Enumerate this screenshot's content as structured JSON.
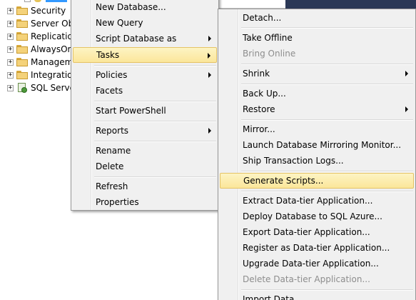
{
  "tree": {
    "items": [
      {
        "label": "Security",
        "icon": "folder-icon"
      },
      {
        "label": "Server Ob",
        "icon": "folder-icon"
      },
      {
        "label": "Replicatio",
        "icon": "folder-icon"
      },
      {
        "label": "AlwaysOr",
        "icon": "folder-icon"
      },
      {
        "label": "Managem",
        "icon": "folder-icon"
      },
      {
        "label": "Integratio",
        "icon": "folder-icon"
      },
      {
        "label": "SQL Serve",
        "icon": "server-icon"
      }
    ],
    "expander_glyph": "+"
  },
  "context_menu": {
    "items": [
      {
        "label": "New Database..."
      },
      {
        "label": "New Query"
      },
      {
        "label": "Script Database as",
        "submenu": true
      },
      {
        "label": "Tasks",
        "submenu": true,
        "highlighted": true
      },
      {
        "label": "Policies",
        "submenu": true
      },
      {
        "label": "Facets"
      },
      {
        "label": "Start PowerShell"
      },
      {
        "label": "Reports",
        "submenu": true
      },
      {
        "label": "Rename"
      },
      {
        "label": "Delete"
      },
      {
        "label": "Refresh"
      },
      {
        "label": "Properties"
      }
    ]
  },
  "tasks_menu": {
    "items": [
      {
        "label": "Detach..."
      },
      {
        "label": "Take Offline"
      },
      {
        "label": "Bring Online",
        "disabled": true
      },
      {
        "label": "Shrink",
        "submenu": true
      },
      {
        "label": "Back Up..."
      },
      {
        "label": "Restore",
        "submenu": true
      },
      {
        "label": "Mirror..."
      },
      {
        "label": "Launch Database Mirroring Monitor..."
      },
      {
        "label": "Ship Transaction Logs..."
      },
      {
        "label": "Generate Scripts...",
        "highlighted": true
      },
      {
        "label": "Extract Data-tier Application..."
      },
      {
        "label": "Deploy Database to SQL Azure..."
      },
      {
        "label": "Export Data-tier Application..."
      },
      {
        "label": "Register as Data-tier Application..."
      },
      {
        "label": "Upgrade Data-tier Application..."
      },
      {
        "label": "Delete Data-tier Application...",
        "disabled": true
      },
      {
        "label": "Import Data..."
      }
    ]
  },
  "colors": {
    "menu_bg": "#f0f0f0",
    "highlight_bg": "#fbe69a",
    "highlight_border": "#e5c365",
    "disabled_text": "#8d8d8d",
    "dark_bg": "#2b3856"
  }
}
